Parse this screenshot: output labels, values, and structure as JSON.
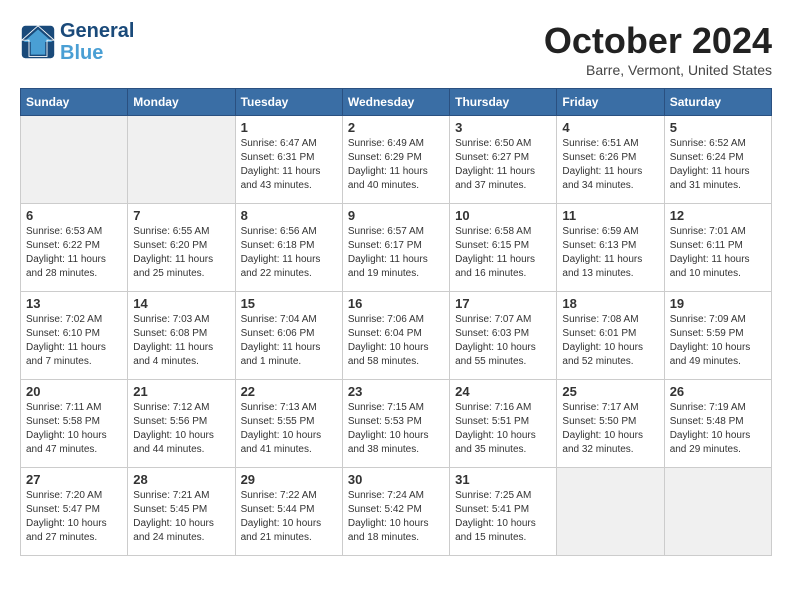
{
  "header": {
    "logo_line1": "General",
    "logo_line2": "Blue",
    "month": "October 2024",
    "location": "Barre, Vermont, United States"
  },
  "weekdays": [
    "Sunday",
    "Monday",
    "Tuesday",
    "Wednesday",
    "Thursday",
    "Friday",
    "Saturday"
  ],
  "weeks": [
    [
      {
        "day": "",
        "empty": true
      },
      {
        "day": "",
        "empty": true
      },
      {
        "day": "1",
        "sunrise": "6:47 AM",
        "sunset": "6:31 PM",
        "daylight": "11 hours and 43 minutes."
      },
      {
        "day": "2",
        "sunrise": "6:49 AM",
        "sunset": "6:29 PM",
        "daylight": "11 hours and 40 minutes."
      },
      {
        "day": "3",
        "sunrise": "6:50 AM",
        "sunset": "6:27 PM",
        "daylight": "11 hours and 37 minutes."
      },
      {
        "day": "4",
        "sunrise": "6:51 AM",
        "sunset": "6:26 PM",
        "daylight": "11 hours and 34 minutes."
      },
      {
        "day": "5",
        "sunrise": "6:52 AM",
        "sunset": "6:24 PM",
        "daylight": "11 hours and 31 minutes."
      }
    ],
    [
      {
        "day": "6",
        "sunrise": "6:53 AM",
        "sunset": "6:22 PM",
        "daylight": "11 hours and 28 minutes."
      },
      {
        "day": "7",
        "sunrise": "6:55 AM",
        "sunset": "6:20 PM",
        "daylight": "11 hours and 25 minutes."
      },
      {
        "day": "8",
        "sunrise": "6:56 AM",
        "sunset": "6:18 PM",
        "daylight": "11 hours and 22 minutes."
      },
      {
        "day": "9",
        "sunrise": "6:57 AM",
        "sunset": "6:17 PM",
        "daylight": "11 hours and 19 minutes."
      },
      {
        "day": "10",
        "sunrise": "6:58 AM",
        "sunset": "6:15 PM",
        "daylight": "11 hours and 16 minutes."
      },
      {
        "day": "11",
        "sunrise": "6:59 AM",
        "sunset": "6:13 PM",
        "daylight": "11 hours and 13 minutes."
      },
      {
        "day": "12",
        "sunrise": "7:01 AM",
        "sunset": "6:11 PM",
        "daylight": "11 hours and 10 minutes."
      }
    ],
    [
      {
        "day": "13",
        "sunrise": "7:02 AM",
        "sunset": "6:10 PM",
        "daylight": "11 hours and 7 minutes."
      },
      {
        "day": "14",
        "sunrise": "7:03 AM",
        "sunset": "6:08 PM",
        "daylight": "11 hours and 4 minutes."
      },
      {
        "day": "15",
        "sunrise": "7:04 AM",
        "sunset": "6:06 PM",
        "daylight": "11 hours and 1 minute."
      },
      {
        "day": "16",
        "sunrise": "7:06 AM",
        "sunset": "6:04 PM",
        "daylight": "10 hours and 58 minutes."
      },
      {
        "day": "17",
        "sunrise": "7:07 AM",
        "sunset": "6:03 PM",
        "daylight": "10 hours and 55 minutes."
      },
      {
        "day": "18",
        "sunrise": "7:08 AM",
        "sunset": "6:01 PM",
        "daylight": "10 hours and 52 minutes."
      },
      {
        "day": "19",
        "sunrise": "7:09 AM",
        "sunset": "5:59 PM",
        "daylight": "10 hours and 49 minutes."
      }
    ],
    [
      {
        "day": "20",
        "sunrise": "7:11 AM",
        "sunset": "5:58 PM",
        "daylight": "10 hours and 47 minutes."
      },
      {
        "day": "21",
        "sunrise": "7:12 AM",
        "sunset": "5:56 PM",
        "daylight": "10 hours and 44 minutes."
      },
      {
        "day": "22",
        "sunrise": "7:13 AM",
        "sunset": "5:55 PM",
        "daylight": "10 hours and 41 minutes."
      },
      {
        "day": "23",
        "sunrise": "7:15 AM",
        "sunset": "5:53 PM",
        "daylight": "10 hours and 38 minutes."
      },
      {
        "day": "24",
        "sunrise": "7:16 AM",
        "sunset": "5:51 PM",
        "daylight": "10 hours and 35 minutes."
      },
      {
        "day": "25",
        "sunrise": "7:17 AM",
        "sunset": "5:50 PM",
        "daylight": "10 hours and 32 minutes."
      },
      {
        "day": "26",
        "sunrise": "7:19 AM",
        "sunset": "5:48 PM",
        "daylight": "10 hours and 29 minutes."
      }
    ],
    [
      {
        "day": "27",
        "sunrise": "7:20 AM",
        "sunset": "5:47 PM",
        "daylight": "10 hours and 27 minutes."
      },
      {
        "day": "28",
        "sunrise": "7:21 AM",
        "sunset": "5:45 PM",
        "daylight": "10 hours and 24 minutes."
      },
      {
        "day": "29",
        "sunrise": "7:22 AM",
        "sunset": "5:44 PM",
        "daylight": "10 hours and 21 minutes."
      },
      {
        "day": "30",
        "sunrise": "7:24 AM",
        "sunset": "5:42 PM",
        "daylight": "10 hours and 18 minutes."
      },
      {
        "day": "31",
        "sunrise": "7:25 AM",
        "sunset": "5:41 PM",
        "daylight": "10 hours and 15 minutes."
      },
      {
        "day": "",
        "empty": true
      },
      {
        "day": "",
        "empty": true
      }
    ]
  ]
}
